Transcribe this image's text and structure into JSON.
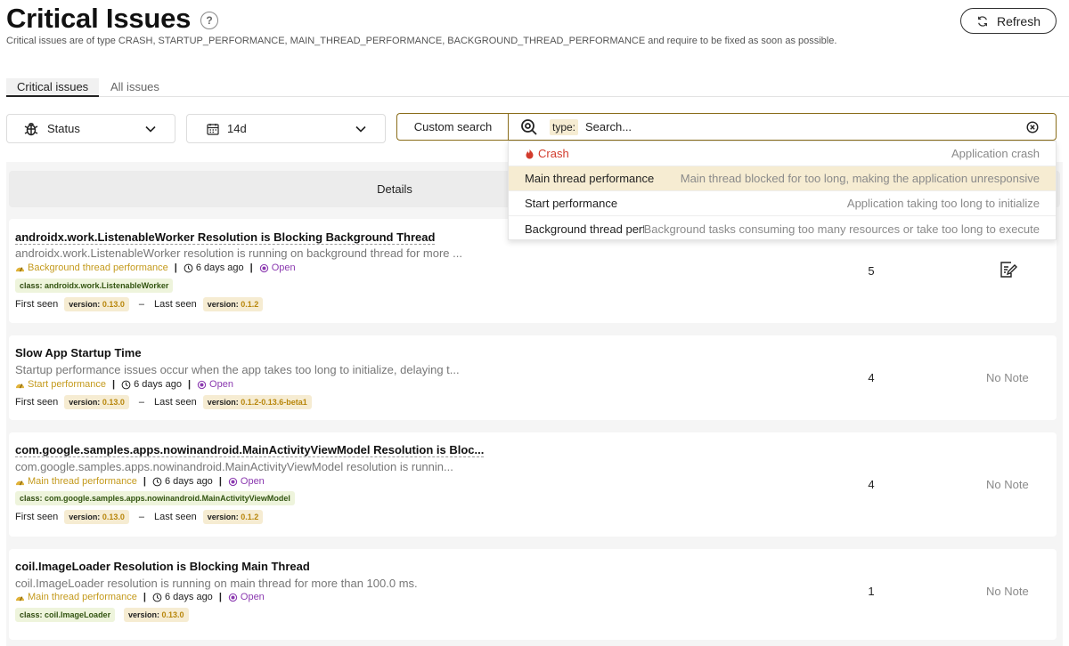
{
  "header": {
    "title": "Critical Issues",
    "help_icon": "?",
    "subtitle": "Critical issues are of type CRASH, STARTUP_PERFORMANCE, MAIN_THREAD_PERFORMANCE, BACKGROUND_THREAD_PERFORMANCE and require to be fixed as soon as possible.",
    "refresh_label": "Refresh"
  },
  "tabs": [
    {
      "label": "Critical issues",
      "active": true
    },
    {
      "label": "All issues",
      "active": false
    }
  ],
  "filters": {
    "status_label": "Status",
    "period_label": "14d",
    "custom_search_label": "Custom search",
    "search_chip": "type:",
    "search_placeholder": "Search..."
  },
  "suggestions": [
    {
      "label": "Crash",
      "description": "Application crash",
      "icon": "fire-icon",
      "color": "#d23b2c"
    },
    {
      "label": "Main thread performance",
      "description": "Main thread blocked for too long, making the application unresponsive",
      "selected": true
    },
    {
      "label": "Start performance",
      "description": "Application taking too long to initialize"
    },
    {
      "label": "Background thread perfc",
      "description": "Background tasks consuming too many resources or take too long to execute"
    }
  ],
  "table": {
    "details_header": "Details"
  },
  "labels": {
    "first_seen": "First seen",
    "last_seen": "Last seen",
    "dash": "–",
    "version_key": "version:",
    "class_key": "class:",
    "sep": "|"
  },
  "issues": [
    {
      "title": "androidx.work.ListenableWorker Resolution is Blocking Background Thread",
      "description": "androidx.work.ListenableWorker resolution is running on background thread for more ...",
      "type": "Background thread performance",
      "time": "6 days ago",
      "status": "Open",
      "class": "androidx.work.ListenableWorker",
      "first_version": "0.13.0",
      "last_version": "0.1.2",
      "count": "5",
      "note": ""
    },
    {
      "title": "Slow App Startup Time",
      "description": "Startup performance issues occur when the app takes too long to initialize, delaying t...",
      "type": "Start performance",
      "time": "6 days ago",
      "status": "Open",
      "first_version": "0.13.0",
      "last_version": "0.1.2-0.13.6-beta1",
      "count": "4",
      "note": "No Note"
    },
    {
      "title": "com.google.samples.apps.nowinandroid.MainActivityViewModel Resolution is Bloc...",
      "description": "com.google.samples.apps.nowinandroid.MainActivityViewModel resolution is runnin...",
      "type": "Main thread performance",
      "time": "6 days ago",
      "status": "Open",
      "class": "com.google.samples.apps.nowinandroid.MainActivityViewModel",
      "first_version": "0.13.0",
      "last_version": "0.1.2",
      "count": "4",
      "note": "No Note"
    },
    {
      "title": "coil.ImageLoader Resolution is Blocking Main Thread",
      "description": "coil.ImageLoader resolution is running on main thread for more than 100.0 ms.",
      "type": "Main thread performance",
      "time": "6 days ago",
      "status": "Open",
      "class": "coil.ImageLoader",
      "version": "0.13.0",
      "count": "1",
      "note": "No Note"
    }
  ],
  "colors": {
    "accent": "#8a6d1a",
    "type_color": "#c49a1c",
    "status_open": "#8b3ab0",
    "crash": "#d23b2c",
    "chip_version_bg": "#f6ecd2",
    "chip_class_bg": "#eef4dc"
  }
}
